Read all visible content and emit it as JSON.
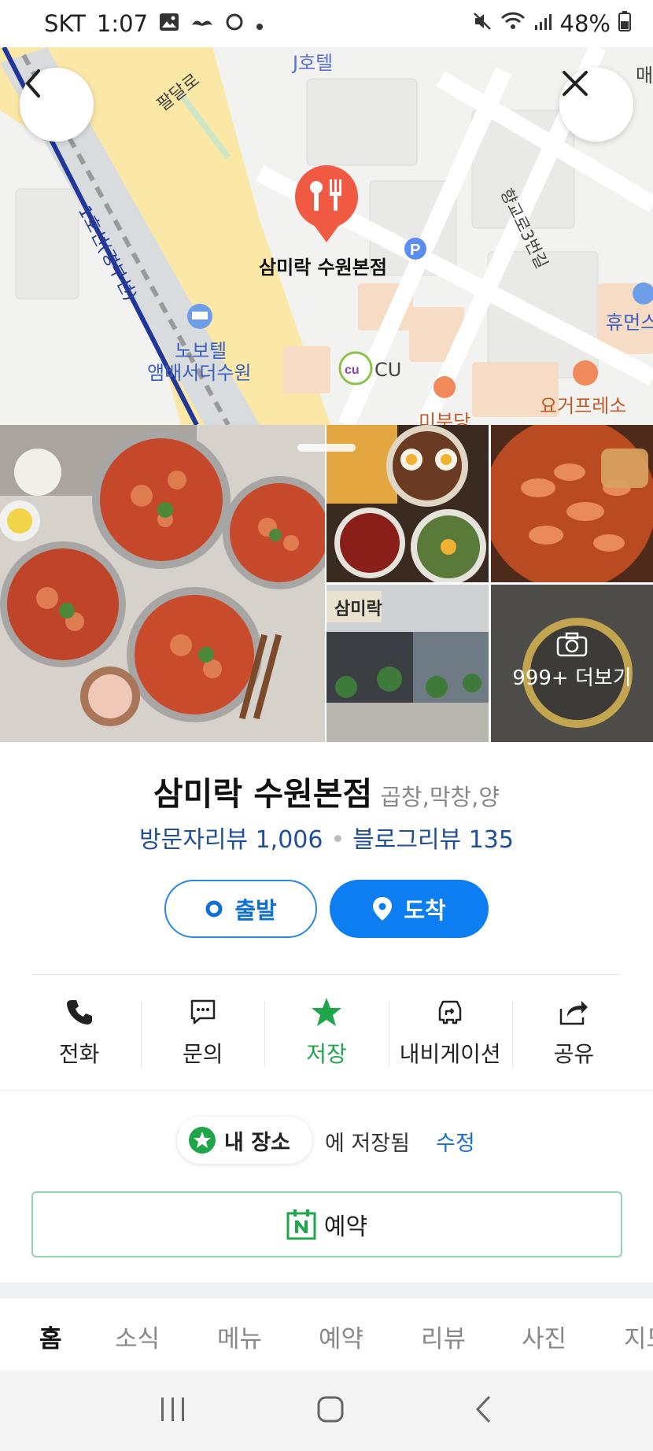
{
  "status_bar": {
    "carrier": "SKT",
    "time": "1:07",
    "battery": "48%"
  },
  "map": {
    "labels": {
      "palldalro": "팔달로",
      "j_hotel": "J호텔",
      "line1": "1호선(경부선)",
      "hyanggyo": "향교로3번길",
      "novotel_1": "노보텔",
      "novotel_2": "앰배서더수원",
      "cu": "CU",
      "mibundang": "미분당",
      "humans": "휴먼스",
      "yogurt": "요거프레소",
      "mae": "매"
    },
    "pin_label": "삼미락 수원본점"
  },
  "photos": {
    "more_label": "999+ 더보기"
  },
  "place": {
    "name": "삼미락 수원본점",
    "category": "곱창,막창,양",
    "visitor_review": "방문자리뷰 1,006",
    "blog_review": "블로그리뷰 135"
  },
  "route": {
    "start_label": "출발",
    "arrive_label": "도착"
  },
  "actions": {
    "call": "전화",
    "inquiry": "문의",
    "save": "저장",
    "navigation": "내비게이션",
    "share": "공유"
  },
  "saved": {
    "my_place": "내 장소",
    "saved_text": "에 저장됨",
    "edit": "수정"
  },
  "reserve": {
    "label": "예약"
  },
  "tabs": [
    "홈",
    "소식",
    "메뉴",
    "예약",
    "리뷰",
    "사진",
    "지도"
  ],
  "colors": {
    "accent_blue": "#0d7df2",
    "save_green": "#1fa54a",
    "pin_red": "#f05a43"
  }
}
